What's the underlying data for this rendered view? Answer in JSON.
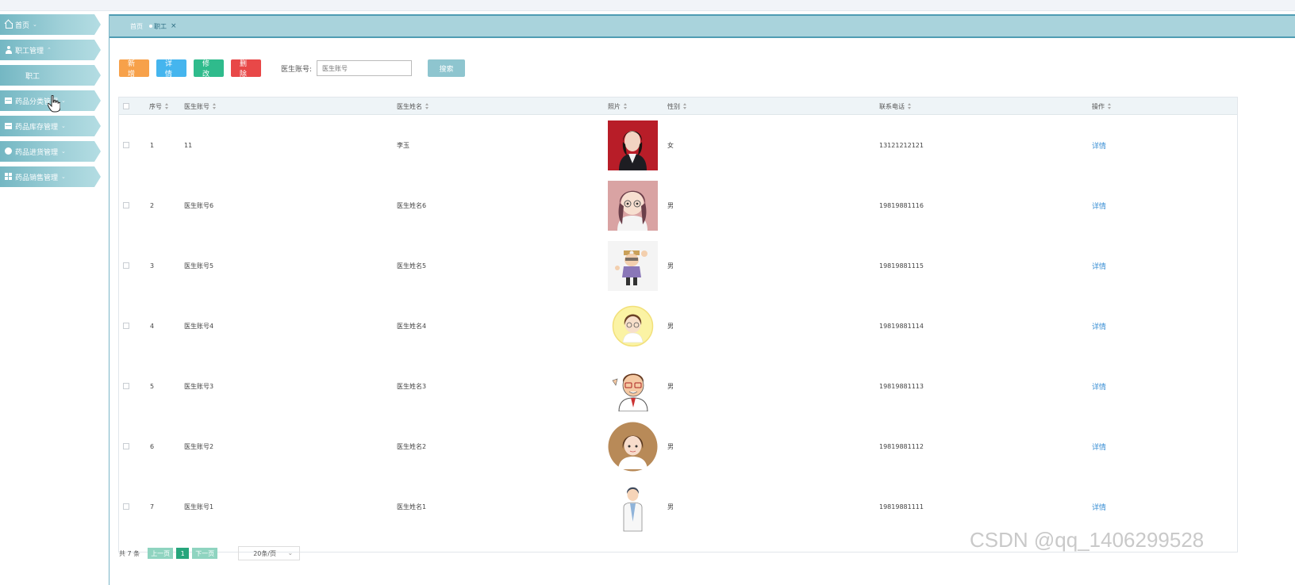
{
  "sidebar": {
    "items": [
      {
        "label": "首页",
        "icon": "home-icon"
      },
      {
        "label": "职工管理",
        "icon": "user-icon"
      },
      {
        "label": "职工",
        "icon": ""
      },
      {
        "label": "药品分类管理",
        "icon": "box-icon"
      },
      {
        "label": "药品库存管理",
        "icon": "box-icon"
      },
      {
        "label": "药品进货管理",
        "icon": "circle-icon"
      },
      {
        "label": "药品销售管理",
        "icon": "grid-icon"
      }
    ]
  },
  "tabs": {
    "home": "首页",
    "active": "职工",
    "close": "×"
  },
  "toolbar": {
    "add": "新增",
    "detail": "详情",
    "edit": "修改",
    "delete": "删除",
    "search_label": "医生账号:",
    "search_placeholder": "医生账号",
    "search_button": "搜索"
  },
  "table": {
    "columns": [
      "序号",
      "医生账号",
      "医生姓名",
      "照片",
      "性别",
      "联系电话",
      "操作"
    ],
    "rows": [
      {
        "no": "1",
        "account": "11",
        "name": "李玉",
        "gender": "女",
        "phone": "13121212121",
        "action": "详情",
        "photo": "photo-woman-portrait"
      },
      {
        "no": "2",
        "account": "医生账号6",
        "name": "医生姓名6",
        "gender": "男",
        "phone": "19819881116",
        "action": "详情",
        "photo": "cartoon-girl-doctor"
      },
      {
        "no": "3",
        "account": "医生账号5",
        "name": "医生姓名5",
        "gender": "男",
        "phone": "19819881115",
        "action": "详情",
        "photo": "cartoon-doctor-thumbs-up"
      },
      {
        "no": "4",
        "account": "医生账号4",
        "name": "医生姓名4",
        "gender": "男",
        "phone": "19819881114",
        "action": "详情",
        "photo": "cartoon-doctor-yellow-circle"
      },
      {
        "no": "5",
        "account": "医生账号3",
        "name": "医生姓名3",
        "gender": "男",
        "phone": "19819881113",
        "action": "详情",
        "photo": "cartoon-doctor-glasses"
      },
      {
        "no": "6",
        "account": "医生账号2",
        "name": "医生姓名2",
        "gender": "男",
        "phone": "19819881112",
        "action": "详情",
        "photo": "cartoon-female-doctor-brown-circle"
      },
      {
        "no": "7",
        "account": "医生账号1",
        "name": "医生姓名1",
        "gender": "男",
        "phone": "19819881111",
        "action": "详情",
        "photo": "cartoon-male-doctor-standing"
      }
    ]
  },
  "pagination": {
    "total": "共 7 条",
    "prev": "上一页",
    "current": "1",
    "next": "下一页",
    "page_size": "20条/页"
  },
  "watermark": "CSDN @qq_1406299528",
  "colors": {
    "accent": "#4f9cb3",
    "add": "#f7a14a",
    "detail": "#45b5ee",
    "edit": "#2fbb8c",
    "delete": "#e84848",
    "search": "#8ec5cf"
  }
}
